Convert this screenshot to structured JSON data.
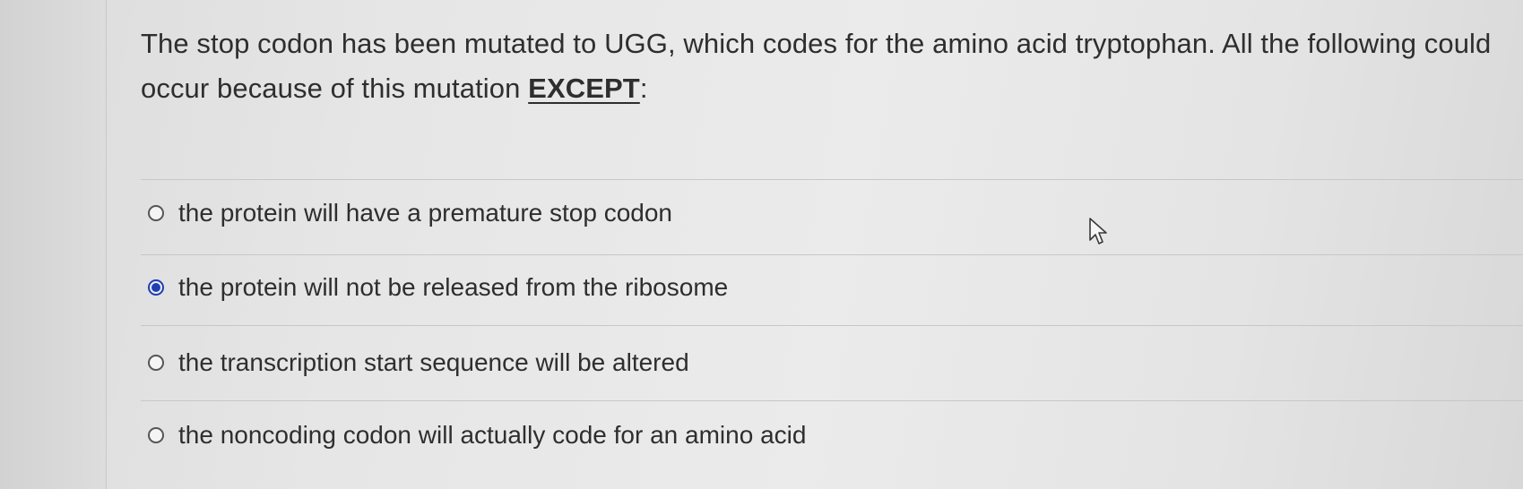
{
  "question": {
    "text_before": "The stop codon has been mutated to UGG, which codes for the amino acid tryptophan. All the following could occur because of this mutation ",
    "emphasis": "EXCEPT",
    "text_after": ":"
  },
  "options": [
    {
      "label": "the protein will have a premature stop codon",
      "selected": false
    },
    {
      "label": "the protein will not be released from the ribosome",
      "selected": true
    },
    {
      "label": "the transcription start sequence will be altered",
      "selected": false
    },
    {
      "label": "the noncoding codon will actually code for an amino acid",
      "selected": false
    }
  ],
  "colors": {
    "selected_radio": "#1f3fb0",
    "text": "#2e2e2e",
    "divider": "#c7c7c7"
  },
  "icons": {
    "cursor": "mouse-pointer-arrow-icon"
  }
}
